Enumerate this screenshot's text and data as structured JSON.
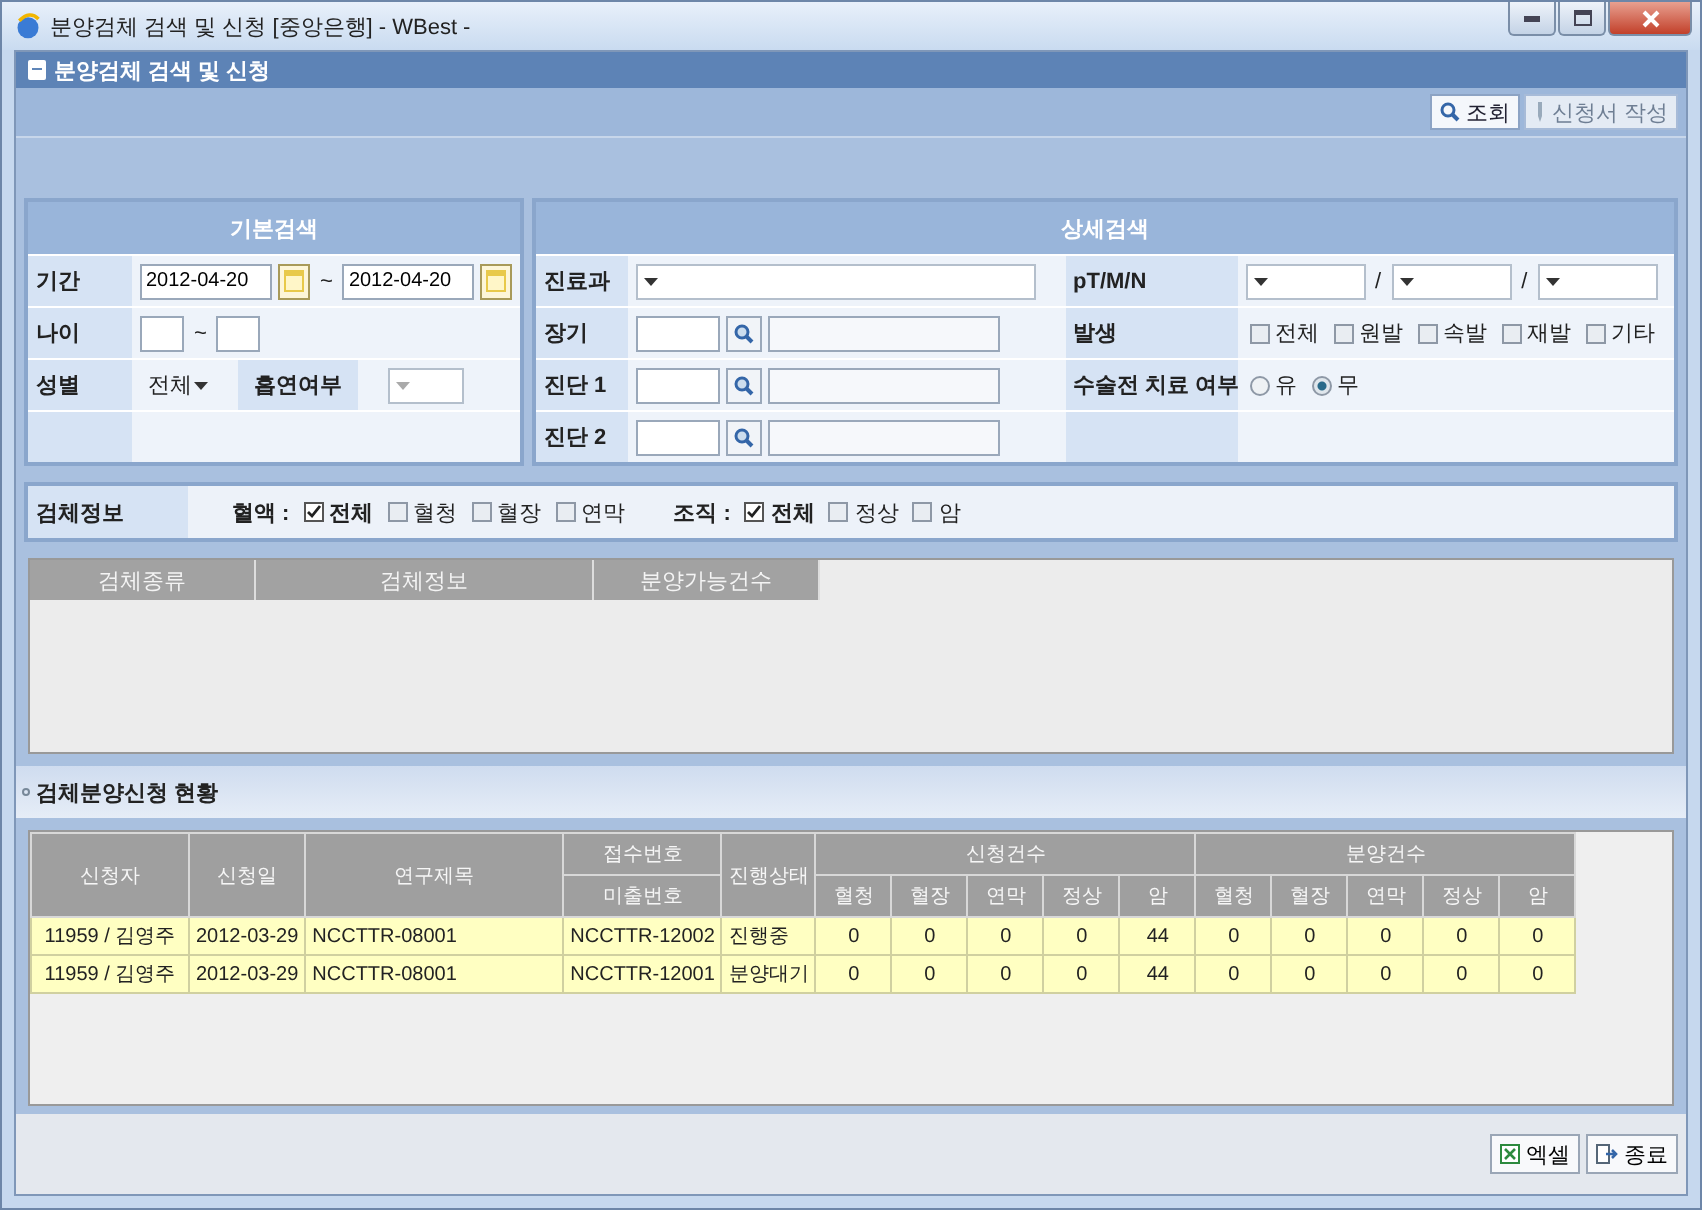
{
  "window": {
    "title": "분양검체 검색 및 신청 [중앙은행] - WBest -"
  },
  "header": {
    "title": "분양검체 검색 및 신청"
  },
  "toolbar": [
    {
      "label": "조회",
      "disabled": false
    },
    {
      "label": "신청서 작성",
      "disabled": true
    }
  ],
  "basic_search": {
    "title": "기본검색",
    "period": {
      "label": "기간",
      "from": "2012-04-20",
      "separator": "~",
      "to": "2012-04-20"
    },
    "age": {
      "label": "나이",
      "separator": "~"
    },
    "sex": {
      "label": "성별",
      "value": "전체"
    },
    "smoking": {
      "label": "흡연여부"
    }
  },
  "detail_search": {
    "title": "상세검색",
    "department": {
      "label": "진료과"
    },
    "organ": {
      "label": "장기"
    },
    "diagnosis_1": {
      "label": "진단 1"
    },
    "diagnosis_2": {
      "label": "진단 2"
    },
    "ptmn": {
      "label": "pT/M/N",
      "separators": [
        "/",
        "/"
      ]
    },
    "occurrence": {
      "label": "발생",
      "options": [
        {
          "label": "전체",
          "checked": false
        },
        {
          "label": "원발",
          "checked": false
        },
        {
          "label": "속발",
          "checked": false
        },
        {
          "label": "재발",
          "checked": false
        },
        {
          "label": "기타",
          "checked": false
        }
      ]
    },
    "preop": {
      "label": "수술전 치료 여부",
      "options": [
        {
          "label": "유",
          "selected": false
        },
        {
          "label": "무",
          "selected": true
        }
      ]
    }
  },
  "specimen_info": {
    "label": "검체정보",
    "groups": [
      {
        "label": "혈액 :",
        "options": [
          {
            "label": "전체",
            "checked": true
          },
          {
            "label": "혈청",
            "checked": false
          },
          {
            "label": "혈장",
            "checked": false
          },
          {
            "label": "연막",
            "checked": false
          }
        ]
      },
      {
        "label": "조직 :",
        "options": [
          {
            "label": "전체",
            "checked": true
          },
          {
            "label": "정상",
            "checked": false
          },
          {
            "label": "암",
            "checked": false
          }
        ]
      }
    ]
  },
  "specimen_table": {
    "columns": [
      "검체종류",
      "검체정보",
      "분양가능건수"
    ]
  },
  "requests": {
    "title": "검체분양신청 현황",
    "columns": {
      "applicant": "신청자",
      "date": "신청일",
      "title": "연구제목",
      "receipt_no": "접수번호",
      "release_no": "미출번호",
      "status": "진행상태",
      "groups": [
        {
          "label": "신청건수",
          "columns": [
            "혈청",
            "혈장",
            "연막",
            "정상",
            "암"
          ]
        },
        {
          "label": "분양건수",
          "columns": [
            "혈청",
            "혈장",
            "연막",
            "정상",
            "암"
          ]
        }
      ]
    },
    "rows": [
      {
        "applicant": "11959 / 김영주",
        "date": "2012-03-29",
        "title": "NCCTTR-08001",
        "number": "NCCTTR-12002",
        "status": "진행중",
        "counts": [
          "0",
          "0",
          "0",
          "0",
          "44",
          "0",
          "0",
          "0",
          "0",
          "0"
        ]
      },
      {
        "applicant": "11959 / 김영주",
        "date": "2012-03-29",
        "title": "NCCTTR-08001",
        "number": "NCCTTR-12001",
        "status": "분양대기",
        "counts": [
          "0",
          "0",
          "0",
          "0",
          "44",
          "0",
          "0",
          "0",
          "0",
          "0"
        ]
      }
    ]
  },
  "footer_buttons": [
    {
      "label": "엑셀",
      "kind": "excel"
    },
    {
      "label": "종료",
      "kind": "exit"
    }
  ]
}
